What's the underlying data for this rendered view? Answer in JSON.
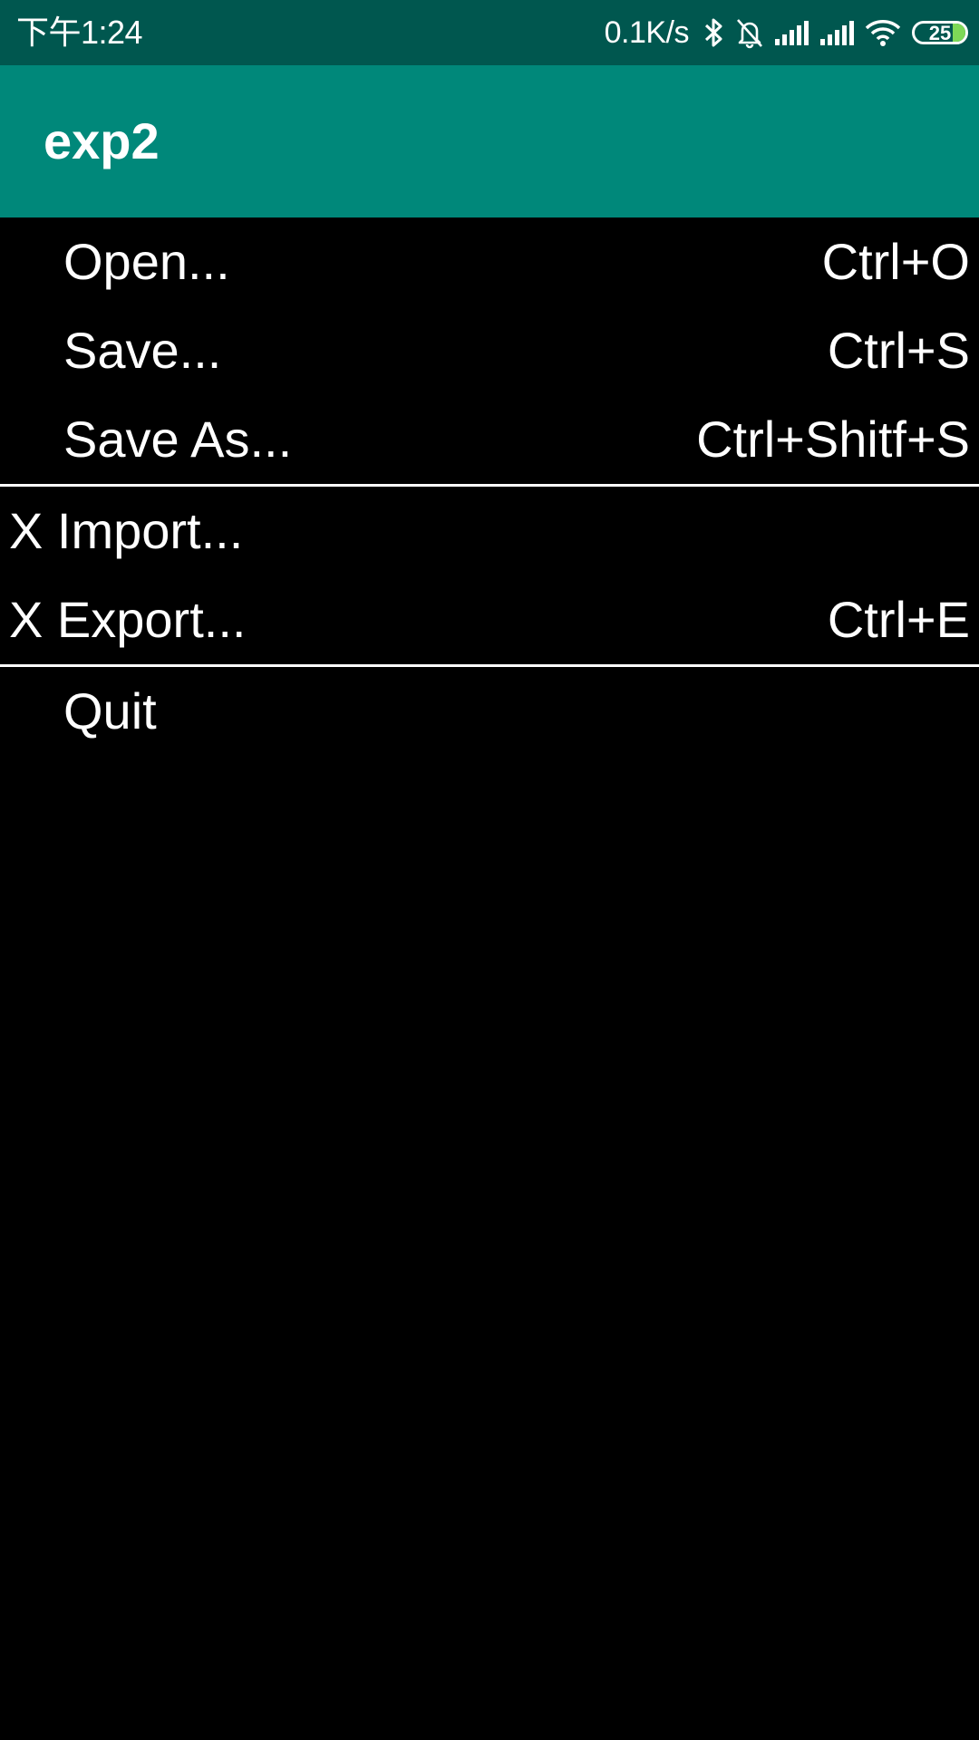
{
  "status_bar": {
    "time": "下午1:24",
    "net_speed": "0.1K/s",
    "icons": [
      "bluetooth-icon",
      "mute-bell-icon",
      "signal-icon",
      "signal-icon",
      "wifi-icon"
    ],
    "battery_level": "25",
    "battery_color": "#7ED957",
    "background": "#00574F"
  },
  "app_bar": {
    "title": "exp2",
    "background": "#00887A"
  },
  "menu": {
    "group1": [
      {
        "label": "Open...",
        "shortcut": "Ctrl+O"
      },
      {
        "label": "Save...",
        "shortcut": "Ctrl+S"
      },
      {
        "label": "Save As...",
        "shortcut": "Ctrl+Shitf+S"
      }
    ],
    "group2": [
      {
        "label": "X Import...",
        "shortcut": ""
      },
      {
        "label": "X Export...",
        "shortcut": "Ctrl+E"
      }
    ],
    "group3": [
      {
        "label": "Quit",
        "shortcut": ""
      }
    ]
  }
}
